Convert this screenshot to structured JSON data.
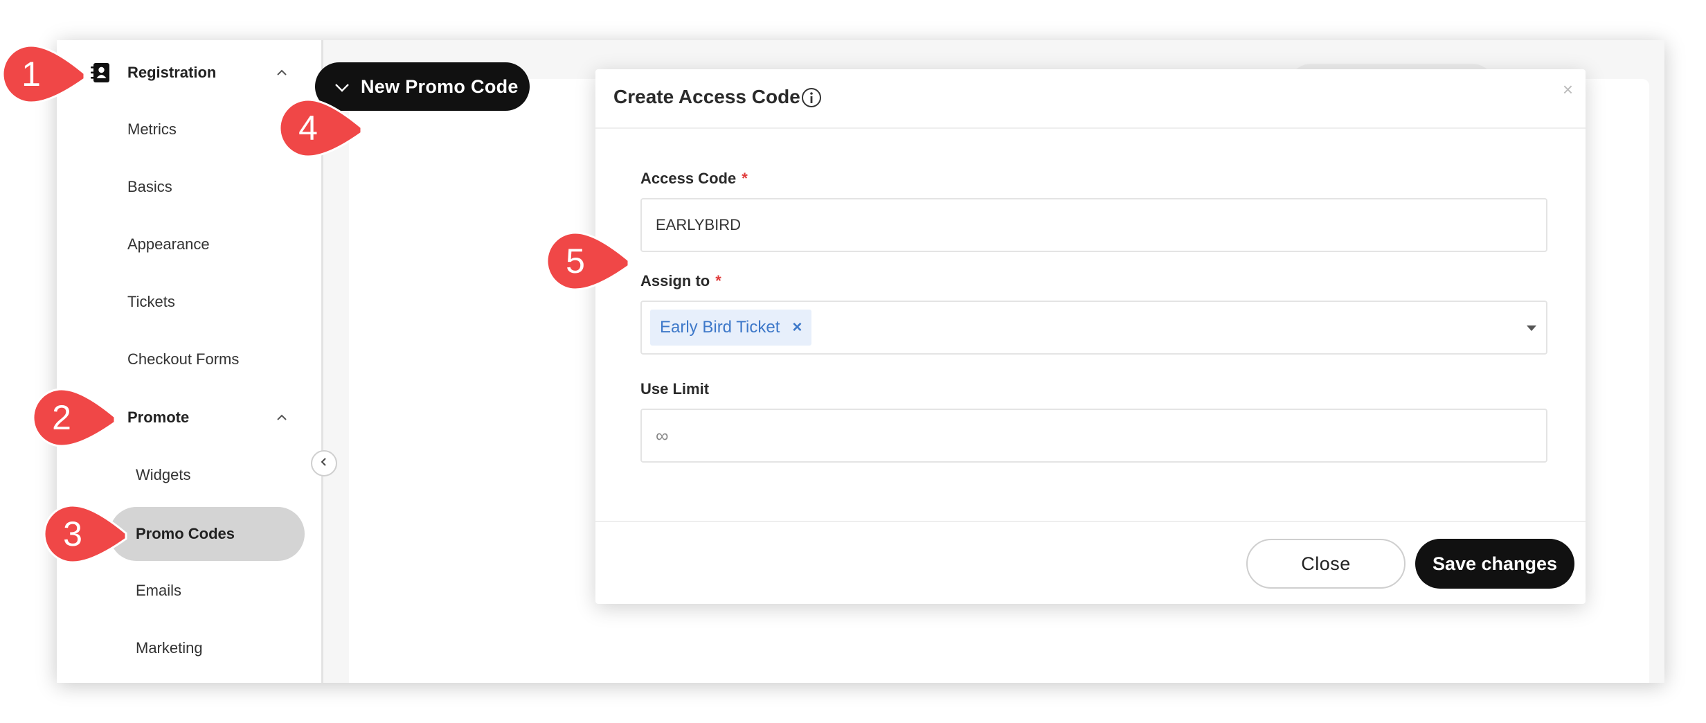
{
  "sidebar": {
    "sections": [
      {
        "label": "Registration",
        "icon": "contact-book-icon"
      },
      {
        "label": "Promote",
        "icon": "megaphone-icon"
      }
    ],
    "registration_items": [
      "Metrics",
      "Basics",
      "Appearance",
      "Tickets",
      "Checkout Forms"
    ],
    "promote_items": [
      "Widgets",
      "Promo Codes",
      "Emails",
      "Marketing"
    ],
    "active_item": "Promo Codes"
  },
  "toolbar": {
    "new_promo_label": "New Promo Code"
  },
  "modal": {
    "title": "Create Access Code",
    "close_symbol": "×",
    "fields": {
      "access_code": {
        "label": "Access Code",
        "required_mark": "*",
        "value": "EARLYBIRD"
      },
      "assign_to": {
        "label": "Assign to",
        "required_mark": "*",
        "tag": "Early Bird Ticket",
        "tag_remove": "×"
      },
      "use_limit": {
        "label": "Use Limit",
        "placeholder": "∞"
      }
    },
    "buttons": {
      "close": "Close",
      "save": "Save changes"
    }
  },
  "callouts": [
    "1",
    "2",
    "3",
    "4",
    "5"
  ],
  "colors": {
    "callout_red": "#f04747",
    "primary_black": "#111111",
    "required_red": "#e03a3a",
    "tag_blue": "#3d78c9",
    "tag_bg": "#e7effb",
    "active_nav_bg": "#d4d4d4"
  }
}
